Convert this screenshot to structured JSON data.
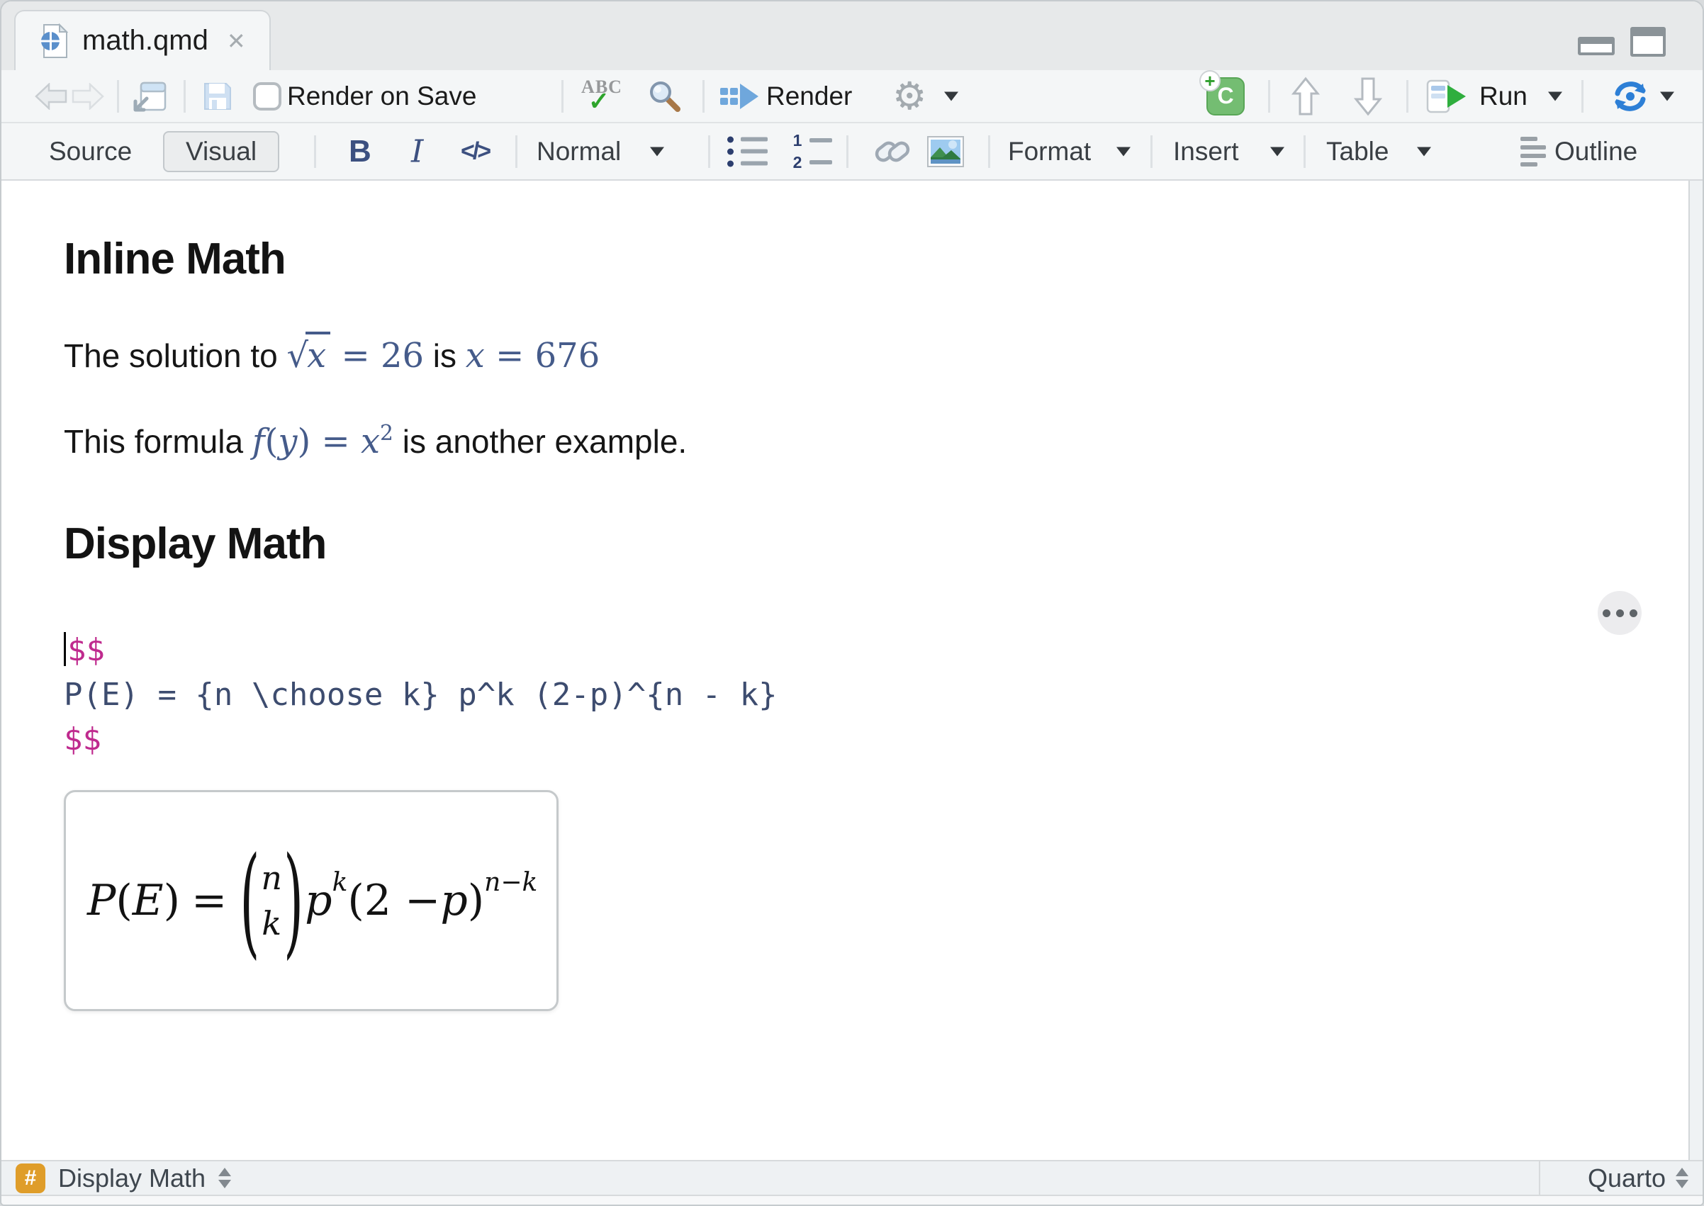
{
  "tab": {
    "title": "math.qmd",
    "close": "✕"
  },
  "toolbar": {
    "render_on_save": "Render on Save",
    "render": "Render",
    "run": "Run"
  },
  "format_bar": {
    "source": "Source",
    "visual": "Visual",
    "bold": "B",
    "italic": "I",
    "code": "</>",
    "paragraph_style": "Normal",
    "format": "Format",
    "insert": "Insert",
    "table": "Table",
    "outline": "Outline"
  },
  "icons": {
    "gear": "⚙",
    "sqrt": "√"
  },
  "document": {
    "heading1": "Inline Math",
    "para1": {
      "prefix": "The solution to ",
      "sqrt_radicand": "x",
      "sqrt_rhs": " = 26",
      "mid": " is ",
      "x_var": "x",
      "x_rhs": " = 676"
    },
    "para2": {
      "prefix": "This formula ",
      "f": "f",
      "open": "(",
      "y": "y",
      "close": ") = ",
      "x": "x",
      "sup": "2",
      "suffix": " is another example."
    },
    "heading2": "Display Math",
    "code": {
      "line1": "$$",
      "line2": "P(E) = {n \\choose k} p^k (2-p)^{n - k}",
      "line3": "$$"
    },
    "equation": {
      "P": "P",
      "openp": "(",
      "E": "E",
      "closep": ")",
      "equals": "=",
      "paren_open": "(",
      "paren_close": ")",
      "binom_top": "n",
      "binom_bottom": "k",
      "p1": "p",
      "sup1": "k",
      "group2": "(2 − ",
      "p2": "p",
      "close2": ")",
      "sup2": "n−k"
    }
  },
  "status_bar": {
    "section_symbol": "#",
    "section": "Display Math",
    "mode": "Quarto"
  },
  "colors": {
    "accent_blue": "#6fa7dc",
    "math_blue": "#455b8a",
    "code_blue": "#3d4c6f",
    "delimiter_magenta": "#bf2a8e",
    "chunk_green": "#74bd72",
    "run_green": "#2fae3e",
    "sync_blue": "#2d7fd6",
    "badge_orange": "#df9d2a",
    "toolbar_bg": "#f4f6f7"
  }
}
